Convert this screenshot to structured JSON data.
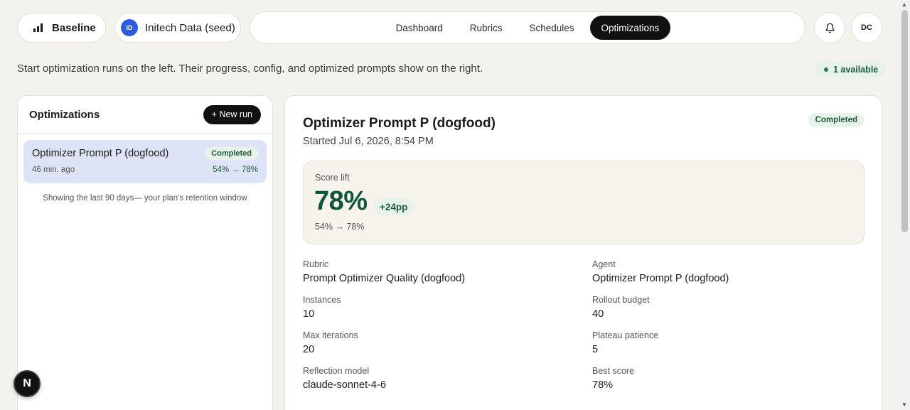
{
  "header": {
    "brand": "Baseline",
    "org": {
      "initials": "ID",
      "name": "Initech Data (seed)"
    },
    "tabs": [
      {
        "label": "Dashboard",
        "active": false
      },
      {
        "label": "Rubrics",
        "active": false
      },
      {
        "label": "Schedules",
        "active": false
      },
      {
        "label": "Optimizations",
        "active": true
      }
    ],
    "user_initials": "DC"
  },
  "intro": "Start optimization runs on the left. Their progress, config, and optimized prompts show on the right.",
  "available_badge": "1 available",
  "left_panel": {
    "title": "Optimizations",
    "new_run_label": "+ New run",
    "runs": [
      {
        "name": "Optimizer Prompt P (dogfood)",
        "status": "Completed",
        "time": "46 min. ago",
        "lift": "54% → 78%"
      }
    ],
    "retention_note": "Showing the last 90 days— your plan's retention window"
  },
  "detail": {
    "title": "Optimizer Prompt P (dogfood)",
    "started": "Started Jul 6, 2026, 8:54 PM",
    "status": "Completed",
    "score": {
      "label": "Score lift",
      "value": "78%",
      "delta": "+24pp",
      "range": "54%  →  78%"
    },
    "fields": [
      {
        "label": "Rubric",
        "value": "Prompt Optimizer Quality (dogfood)"
      },
      {
        "label": "Agent",
        "value": "Optimizer Prompt P (dogfood)"
      },
      {
        "label": "Instances",
        "value": "10"
      },
      {
        "label": "Rollout budget",
        "value": "40"
      },
      {
        "label": "Max iterations",
        "value": "20"
      },
      {
        "label": "Plateau patience",
        "value": "5"
      },
      {
        "label": "Reflection model",
        "value": "claude-sonnet-4-6"
      },
      {
        "label": "Best score",
        "value": "78%"
      }
    ]
  },
  "fab_label": "N",
  "colors": {
    "accent": "#111111",
    "success": "#125437",
    "selected_row": "#dde4f8",
    "org_avatar": "#2f5bd8"
  }
}
